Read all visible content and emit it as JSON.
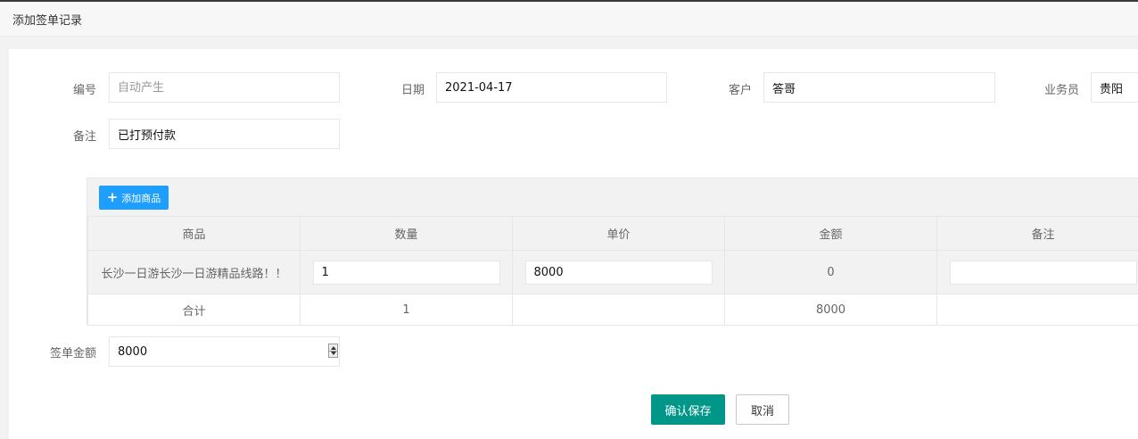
{
  "window": {
    "title": "添加签单记录"
  },
  "form": {
    "number": {
      "label": "编号",
      "value": "",
      "placeholder": "自动产生"
    },
    "date": {
      "label": "日期",
      "value": "2021-04-17"
    },
    "customer": {
      "label": "客户",
      "value": "答哥"
    },
    "salesperson": {
      "label": "业务员",
      "value": "贵阳"
    },
    "remark": {
      "label": "备注",
      "value": "已打预付款"
    },
    "amount": {
      "label": "签单金额",
      "value": "8000"
    }
  },
  "table": {
    "add_button_label": "添加商品",
    "headers": [
      "商品",
      "数量",
      "单价",
      "金额",
      "备注"
    ],
    "rows": [
      {
        "product": "长沙一日游长沙一日游精品线路！！",
        "quantity": "1",
        "price": "8000",
        "amount": "0",
        "remark": ""
      }
    ],
    "total": {
      "label": "合计",
      "quantity": "1",
      "price": "",
      "amount": "8000",
      "remark": ""
    }
  },
  "actions": {
    "save_label": "确认保存",
    "cancel_label": "取消"
  },
  "colors": {
    "primary": "#009688",
    "accent": "#1e9fff"
  },
  "icons": {
    "add": "plus-icon",
    "stepper": "spinner-arrows-icon"
  }
}
